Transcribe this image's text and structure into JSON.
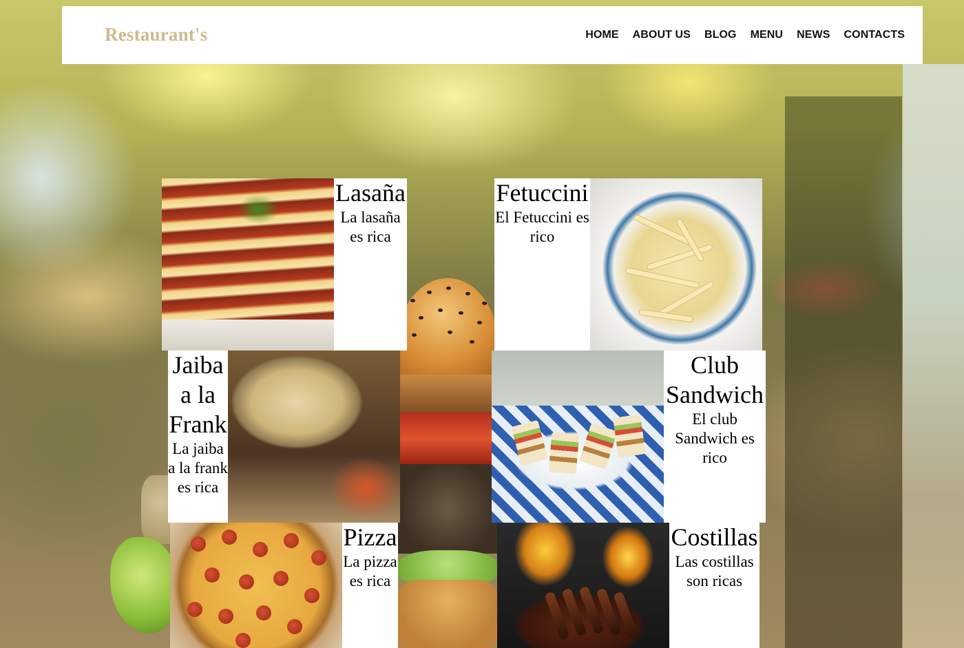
{
  "header": {
    "brand": "Restaurant's",
    "nav": [
      {
        "label": "HOME"
      },
      {
        "label": "ABOUT US"
      },
      {
        "label": "BLOG"
      },
      {
        "label": "MENU"
      },
      {
        "label": "NEWS"
      },
      {
        "label": "CONTACTS"
      }
    ]
  },
  "colors": {
    "brand": "#d0b98d",
    "nav_text": "#111111",
    "header_bg": "#ffffff"
  },
  "menu": [
    {
      "name": "Lasaña",
      "description": "La lasaña es rica"
    },
    {
      "name": "Fetuccini",
      "description": "El Fetuccini es rico"
    },
    {
      "name": "Jaiba a la Frank",
      "description": "La jaiba a la frank es rica"
    },
    {
      "name": "Club Sandwich",
      "description": "El club Sandwich es rico"
    },
    {
      "name": "Pizza",
      "description": "La pizza es rica"
    },
    {
      "name": "Costillas",
      "description": "Las costillas son ricas"
    }
  ]
}
